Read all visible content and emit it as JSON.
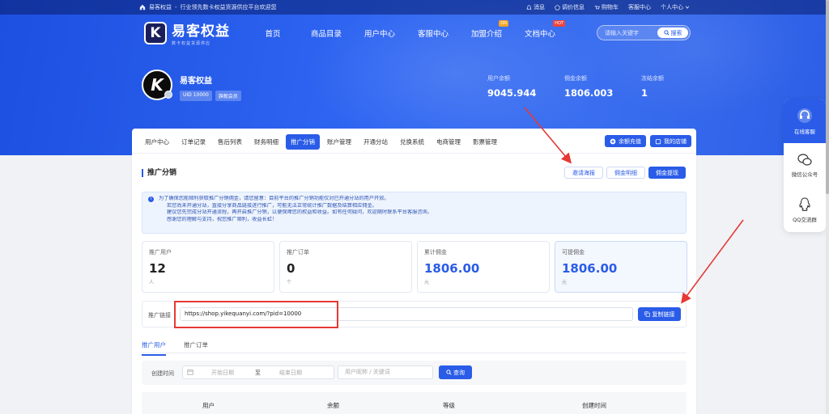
{
  "topbar": {
    "brand": "易客权益",
    "separator": "-",
    "tagline": "行业领先数卡权益货源供应平台欢迎您",
    "links": [
      "消息",
      "调价信息",
      "购物车",
      "客服中心",
      "个人中心"
    ]
  },
  "logo": {
    "mark": "K",
    "name": "易客权益",
    "slogan": "数卡权益货源供应"
  },
  "menu": {
    "items": [
      "首页",
      "商品目录",
      "用户中心",
      "客服中心",
      "加盟介绍",
      "文档中心"
    ],
    "badges": {
      "join": "ON",
      "docs": "HOT"
    }
  },
  "search": {
    "placeholder": "请输入关键字",
    "button": "搜索"
  },
  "profile": {
    "name": "易客权益",
    "uid": "UID 10000",
    "level": "旗舰会员",
    "avatar_letter": "K"
  },
  "stats": [
    {
      "label": "用户余额",
      "value": "9045.944"
    },
    {
      "label": "佣金余额",
      "value": "1806.003"
    },
    {
      "label": "冻结余额",
      "value": "1"
    }
  ],
  "tabs": [
    "用户中心",
    "订单记录",
    "售后列表",
    "财务明细",
    "推广分销",
    "账户管理",
    "开通分站",
    "兑换系统",
    "电商管理",
    "影票管理"
  ],
  "top_buttons": {
    "recharge": "余额充值",
    "shop": "我的店铺"
  },
  "section": {
    "title": "推广分销",
    "buttons": [
      "邀请海报",
      "佣金明细",
      "佣金提现"
    ]
  },
  "notice": [
    "为了确保您能顺利获取推广分销佣金，请您留意：目前平台的推广分销功能仅对已开通分站的用户开放。",
    "若您尚未开通分站，直接分享商品链接进行推广，可能无法正常统计推广数据及结算相应佣金。",
    "建议您先完成分站开通流程，再开启推广分销，以便保障您的权益和收益。如有任何疑问，欢迎随时联系平台客服咨询。",
    "感谢您的理解与支持，祝您推广顺利，收益长虹！"
  ],
  "metrics": [
    {
      "label": "推广用户",
      "value": "12",
      "unit": "人"
    },
    {
      "label": "推广订单",
      "value": "0",
      "unit": "个"
    },
    {
      "label": "累计佣金",
      "value": "1806.00",
      "unit": "元"
    },
    {
      "label": "可提佣金",
      "value": "1806.00",
      "unit": "元"
    }
  ],
  "link": {
    "label": "推广链接",
    "value": "https://shop.yikequanyi.com/?pid=10000",
    "copy": "复制链接"
  },
  "subtabs": [
    "推广用户",
    "推广订单"
  ],
  "filter": {
    "label": "创建时间",
    "start_placeholder": "开始日期",
    "separator": "至",
    "end_placeholder": "结束日期",
    "keyword_placeholder": "用户昵称 / 关键词",
    "query": "查询"
  },
  "table_headers": [
    "用户",
    "余额",
    "等级",
    "创建时间"
  ],
  "side": [
    "在线客服",
    "微信公众号",
    "QQ交流群"
  ],
  "colors": {
    "primary": "#2a5ce8",
    "hero": "#2f66f2",
    "annotation": "#e53935"
  }
}
